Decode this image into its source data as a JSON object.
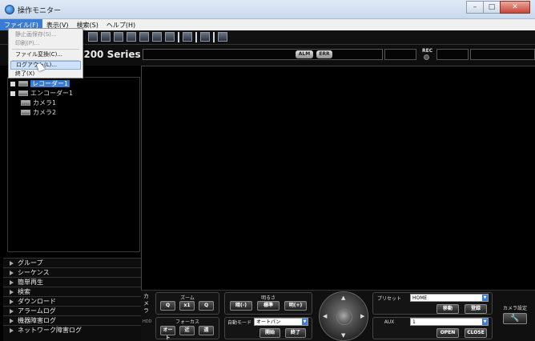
{
  "window": {
    "title": "操作モニター",
    "controls": {
      "minimize": "–",
      "maximize": "□",
      "close": "✕"
    }
  },
  "menubar": {
    "items": [
      "ファイル(F)",
      "表示(V)",
      "検索(S)",
      "ヘルプ(H)"
    ]
  },
  "file_menu": {
    "items": [
      {
        "label": "静止画保存(S)...",
        "enabled": false
      },
      {
        "label": "印刷(P)...",
        "enabled": false
      },
      {
        "label": "ファイル変換(C)...",
        "enabled": true
      },
      {
        "label": "ログアウト(L)...",
        "enabled": true,
        "hover": true
      },
      {
        "label": "終了(X)",
        "enabled": true
      }
    ]
  },
  "header": {
    "series_title": "1200 Series",
    "alarm_chip": "ALM",
    "error_chip": "ERR",
    "rec_label": "REC"
  },
  "tree": {
    "items": [
      {
        "label": "レコーダー1",
        "selected": true
      },
      {
        "label": "エンコーダー1",
        "selected": false
      },
      {
        "label": "カメラ1",
        "selected": false
      },
      {
        "label": "カメラ2",
        "selected": false
      }
    ]
  },
  "nav": {
    "items": [
      "グループ",
      "シーケンス",
      "簡単再生",
      "検索",
      "ダウンロード",
      "アラームログ",
      "機器障害ログ",
      "ネットワーク障害ログ"
    ]
  },
  "camera_panel": {
    "side_label_top": "カメラ",
    "side_label_bottom": "HDD",
    "zoom": {
      "label": "ズーム",
      "out": "Q",
      "x1": "x1",
      "in": "Q"
    },
    "focus": {
      "label": "フォーカス",
      "auto": "オート",
      "near": "近",
      "far": "遠"
    },
    "brightness": {
      "label": "明るさ",
      "dark": "暗(-)",
      "standard": "標準",
      "bright": "明(+)"
    },
    "auto_mode": {
      "label": "自動モード",
      "value": "オートパン",
      "start": "開始",
      "stop": "終了"
    },
    "preset": {
      "label": "プリセット",
      "value": "HOME",
      "move": "移動",
      "register": "登録"
    },
    "aux": {
      "label": "AUX",
      "value": "1",
      "open": "OPEN",
      "close": "CLOSE"
    },
    "camera_settings": "カメラ設定"
  },
  "colors": {
    "selection": "#3a7bd5",
    "background": "#000000"
  }
}
